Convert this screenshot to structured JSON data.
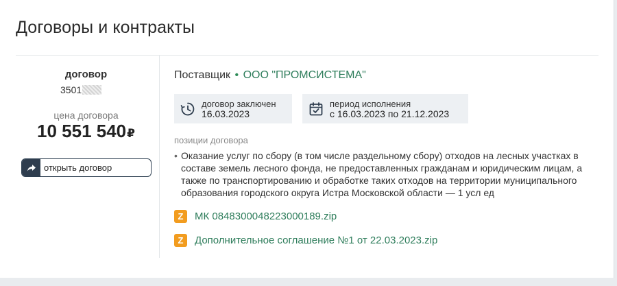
{
  "page": {
    "title": "Договоры и контракты"
  },
  "contract": {
    "label": "договор",
    "number_prefix": "3501",
    "price_label": "цена договора",
    "price": "10 551 540",
    "currency": "₽",
    "open_button": "открыть договор"
  },
  "supplier": {
    "label": "Поставщик",
    "separator": "•",
    "name": "ООО \"ПРОМСИСТЕМА\""
  },
  "dates": {
    "concluded_label": "договор заключен",
    "concluded_value": "16.03.2023",
    "period_label": "период исполнения",
    "period_value": "с 16.03.2023 по 21.12.2023"
  },
  "positions": {
    "label": "позиции договора",
    "bullet": "•",
    "items": [
      "Оказание услуг по сбору (в том числе раздельному сбору) отходов на лесных участках в составе земель лесного фонда, не предоставленных гражданам и юридическим лицам, а также по транспортированию и обработке таких отходов на территории муниципального образования городского округа Истра Московской области — 1 усл ед"
    ]
  },
  "files": [
    {
      "badge": "Z",
      "name": "МК 0848300048223000189.zip"
    },
    {
      "badge": "Z",
      "name": "Дополнительное соглашение №1 от 22.03.2023.zip"
    }
  ],
  "colors": {
    "accent_green": "#2e7d5b",
    "zip_orange": "#f29c1f",
    "dark_button": "#2e3d4e",
    "info_box_bg": "#edf0f3"
  },
  "icons": {
    "open_button": "share-arrow-icon",
    "concluded": "clock-icon",
    "period": "calendar-check-icon",
    "file": "zip-file-icon"
  }
}
